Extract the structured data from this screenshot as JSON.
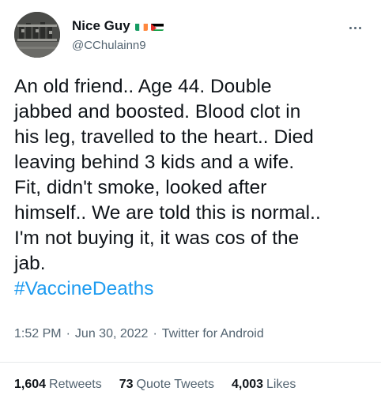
{
  "author": {
    "display_name": "Nice Guy",
    "handle": "@CChulainn9",
    "flags": [
      "ireland-flag-icon",
      "palestine-flag-icon"
    ]
  },
  "tweet": {
    "lines": [
      "An old friend.. Age 44. Double",
      "jabbed and boosted. Blood clot in",
      "his leg, travelled to the heart.. Died",
      "leaving behind 3 kids and a wife.",
      "Fit, didn't smoke, looked after",
      "himself.. We are told this is normal..",
      "I'm not buying it, it was cos of the",
      "jab."
    ],
    "hashtag": "#VaccineDeaths"
  },
  "meta": {
    "time": "1:52 PM",
    "date": "Jun 30, 2022",
    "source": "Twitter for Android",
    "separator": "·"
  },
  "stats": {
    "retweets_count": "1,604",
    "retweets_label": "Retweets",
    "quotes_count": "73",
    "quotes_label": "Quote Tweets",
    "likes_count": "4,003",
    "likes_label": "Likes"
  },
  "colors": {
    "text": "#0f1419",
    "secondary": "#536471",
    "link": "#1d9bf0"
  }
}
